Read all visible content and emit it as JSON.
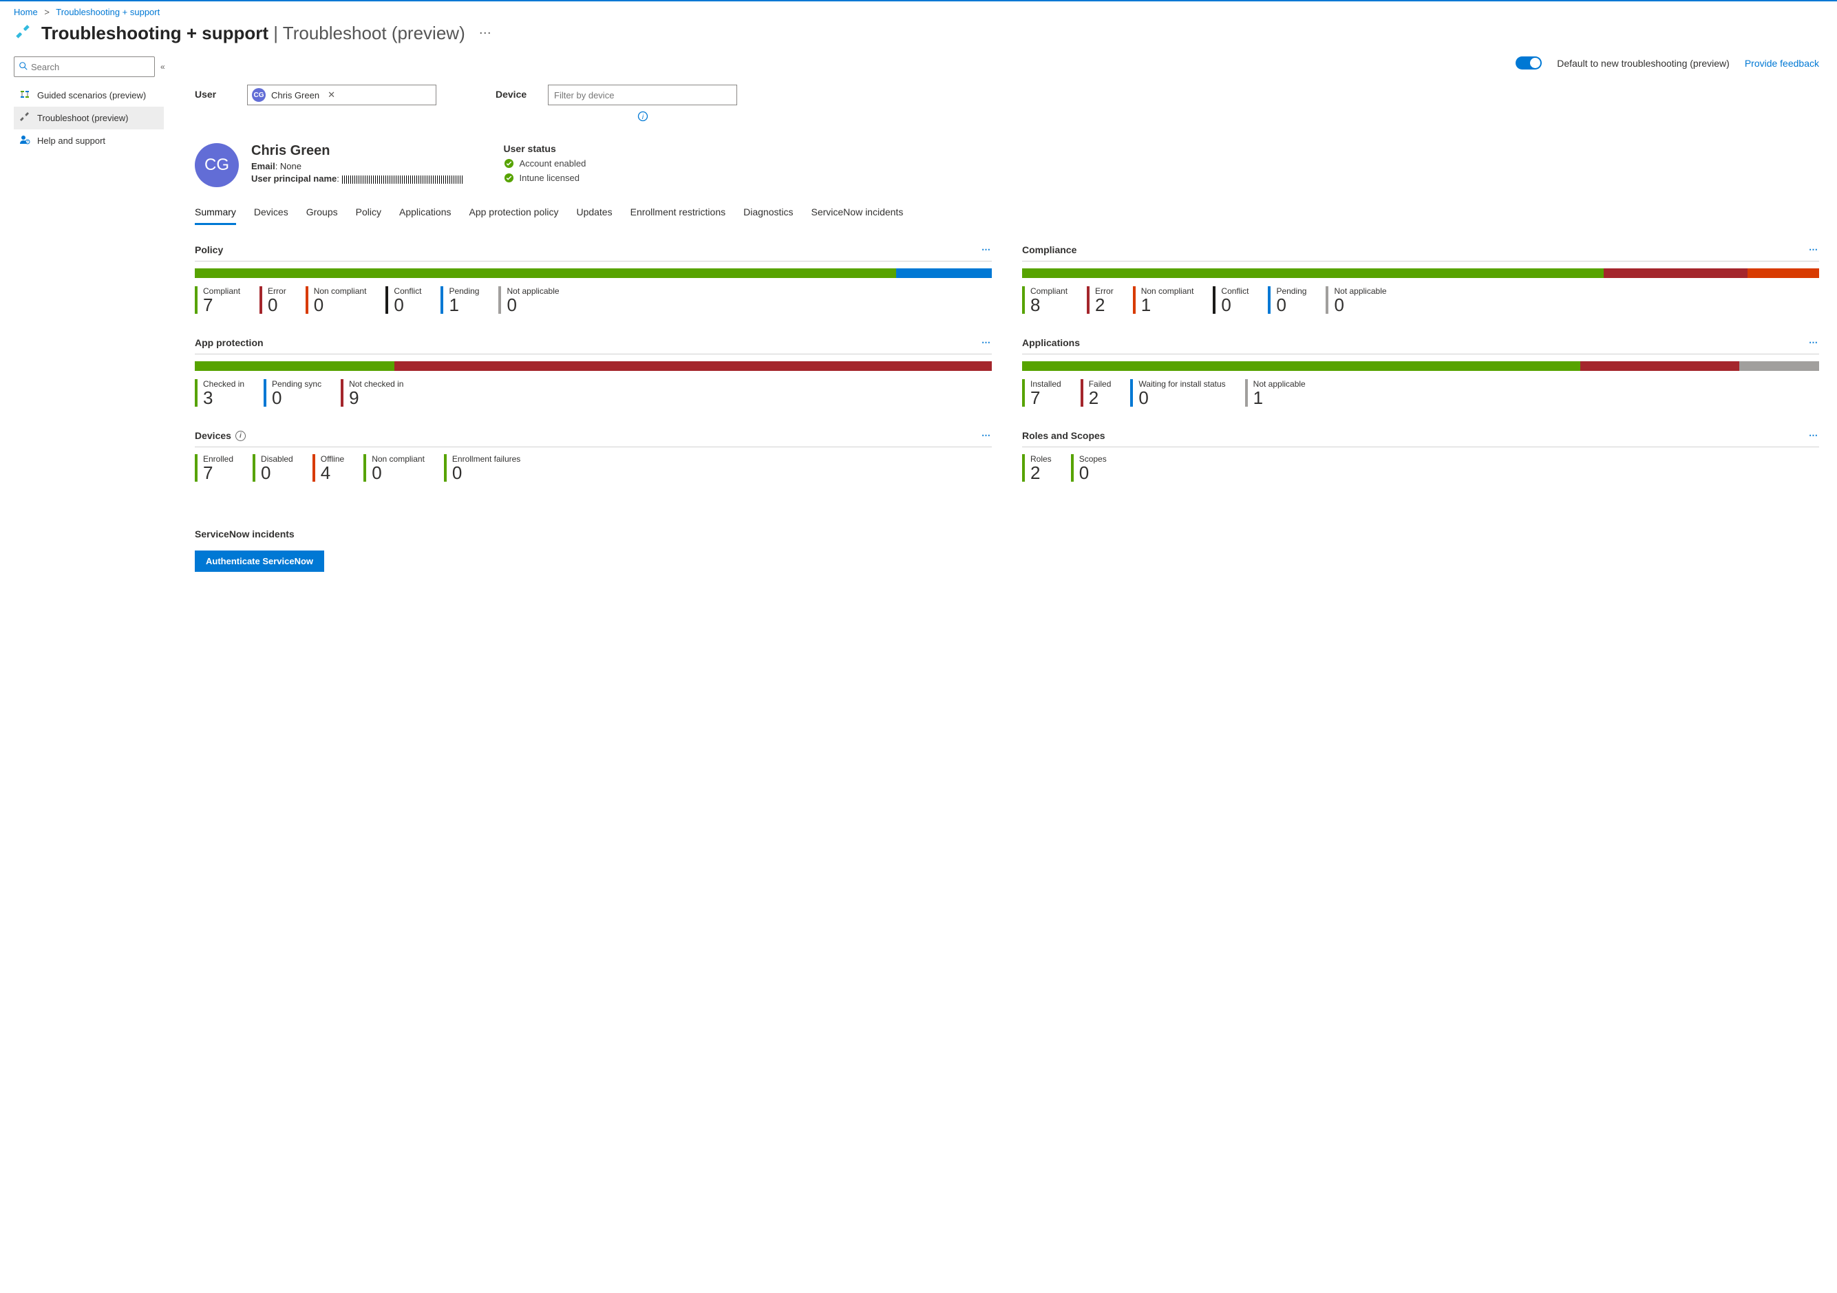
{
  "breadcrumb": {
    "home": "Home",
    "current": "Troubleshooting + support"
  },
  "title": {
    "main": "Troubleshooting + support",
    "sub": "Troubleshoot (preview)"
  },
  "sidebar": {
    "search_ph": "Search",
    "items": [
      {
        "label": "Guided scenarios (preview)"
      },
      {
        "label": "Troubleshoot (preview)"
      },
      {
        "label": "Help and support"
      }
    ]
  },
  "topbar": {
    "toggle_label": "Default to new troubleshooting (preview)",
    "feedback": "Provide feedback"
  },
  "filters": {
    "user_label": "User",
    "user_chip": "Chris Green",
    "user_initials": "CG",
    "device_label": "Device",
    "device_ph": "Filter by device"
  },
  "overview": {
    "initials": "CG",
    "name": "Chris Green",
    "email_label": "Email",
    "email_value": "None",
    "upn_label": "User principal name",
    "status_hdr": "User status",
    "status1": "Account enabled",
    "status2": "Intune licensed"
  },
  "tabs": [
    "Summary",
    "Devices",
    "Groups",
    "Policy",
    "Applications",
    "App protection policy",
    "Updates",
    "Enrollment restrictions",
    "Diagnostics",
    "ServiceNow incidents"
  ],
  "cards": {
    "policy": {
      "title": "Policy",
      "segments": [
        {
          "c": "c-green",
          "w": 88
        },
        {
          "c": "c-blue",
          "w": 12
        }
      ],
      "stats": [
        {
          "l": "Compliant",
          "v": "7",
          "c": "c-green"
        },
        {
          "l": "Error",
          "v": "0",
          "c": "c-red"
        },
        {
          "l": "Non compliant",
          "v": "0",
          "c": "c-orange"
        },
        {
          "l": "Conflict",
          "v": "0",
          "c": "c-black"
        },
        {
          "l": "Pending",
          "v": "1",
          "c": "c-blue"
        },
        {
          "l": "Not applicable",
          "v": "0",
          "c": "c-grey"
        }
      ]
    },
    "compliance": {
      "title": "Compliance",
      "segments": [
        {
          "c": "c-green",
          "w": 73
        },
        {
          "c": "c-red",
          "w": 18
        },
        {
          "c": "c-orange",
          "w": 9
        }
      ],
      "stats": [
        {
          "l": "Compliant",
          "v": "8",
          "c": "c-green"
        },
        {
          "l": "Error",
          "v": "2",
          "c": "c-red"
        },
        {
          "l": "Non compliant",
          "v": "1",
          "c": "c-orange"
        },
        {
          "l": "Conflict",
          "v": "0",
          "c": "c-black"
        },
        {
          "l": "Pending",
          "v": "0",
          "c": "c-blue"
        },
        {
          "l": "Not applicable",
          "v": "0",
          "c": "c-grey"
        }
      ]
    },
    "appprotection": {
      "title": "App protection",
      "segments": [
        {
          "c": "c-green",
          "w": 25
        },
        {
          "c": "c-red",
          "w": 75
        }
      ],
      "stats": [
        {
          "l": "Checked in",
          "v": "3",
          "c": "c-green"
        },
        {
          "l": "Pending sync",
          "v": "0",
          "c": "c-blue"
        },
        {
          "l": "Not checked in",
          "v": "9",
          "c": "c-red"
        }
      ]
    },
    "applications": {
      "title": "Applications",
      "segments": [
        {
          "c": "c-green",
          "w": 70
        },
        {
          "c": "c-red",
          "w": 20
        },
        {
          "c": "c-grey",
          "w": 10
        }
      ],
      "stats": [
        {
          "l": "Installed",
          "v": "7",
          "c": "c-green"
        },
        {
          "l": "Failed",
          "v": "2",
          "c": "c-red"
        },
        {
          "l": "Waiting for install status",
          "v": "0",
          "c": "c-blue"
        },
        {
          "l": "Not applicable",
          "v": "1",
          "c": "c-grey"
        }
      ]
    },
    "devices": {
      "title": "Devices",
      "info": true,
      "stats": [
        {
          "l": "Enrolled",
          "v": "7",
          "c": "c-green"
        },
        {
          "l": "Disabled",
          "v": "0",
          "c": "c-green"
        },
        {
          "l": "Offline",
          "v": "4",
          "c": "c-orange"
        },
        {
          "l": "Non compliant",
          "v": "0",
          "c": "c-green"
        },
        {
          "l": "Enrollment failures",
          "v": "0",
          "c": "c-green"
        }
      ]
    },
    "roles": {
      "title": "Roles and Scopes",
      "stats": [
        {
          "l": "Roles",
          "v": "2",
          "c": "c-green"
        },
        {
          "l": "Scopes",
          "v": "0",
          "c": "c-green"
        }
      ]
    }
  },
  "servicenow": {
    "title": "ServiceNow incidents",
    "button": "Authenticate ServiceNow"
  }
}
